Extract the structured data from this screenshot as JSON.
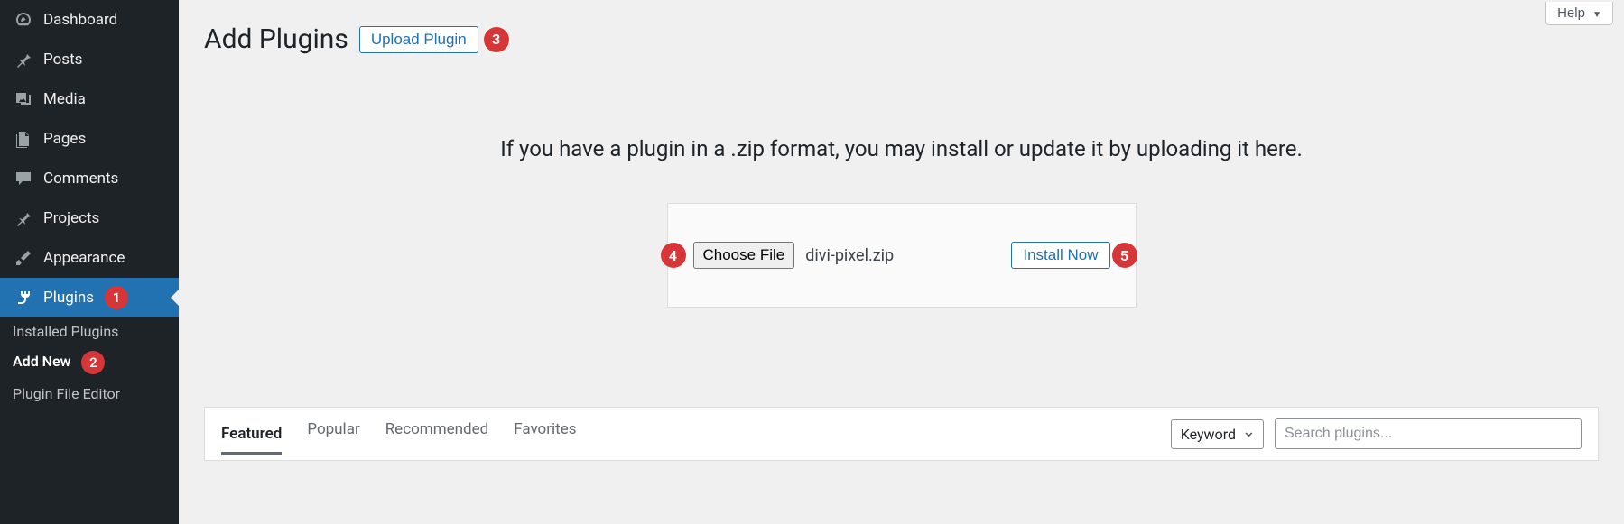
{
  "sidebar": {
    "items": [
      {
        "label": "Dashboard",
        "icon": "gauge"
      },
      {
        "label": "Posts",
        "icon": "pin"
      },
      {
        "label": "Media",
        "icon": "media"
      },
      {
        "label": "Pages",
        "icon": "pages"
      },
      {
        "label": "Comments",
        "icon": "comment"
      },
      {
        "label": "Projects",
        "icon": "pin"
      },
      {
        "label": "Appearance",
        "icon": "brush"
      },
      {
        "label": "Plugins",
        "icon": "plug",
        "active": true,
        "badge": "1"
      }
    ],
    "submenu": [
      {
        "label": "Installed Plugins"
      },
      {
        "label": "Add New",
        "bold": true,
        "badge": "2"
      },
      {
        "label": "Plugin File Editor"
      }
    ]
  },
  "header": {
    "help_label": "Help",
    "page_title": "Add Plugins",
    "upload_button": "Upload Plugin",
    "upload_badge": "3"
  },
  "upload": {
    "instructions": "If you have a plugin in a .zip format, you may install or update it by uploading it here.",
    "choose_file_label": "Choose File",
    "file_name": "divi-pixel.zip",
    "install_label": "Install Now",
    "badge_choose": "4",
    "badge_install": "5"
  },
  "filter": {
    "tabs": [
      "Featured",
      "Popular",
      "Recommended",
      "Favorites"
    ],
    "active_tab": "Featured",
    "keyword_label": "Keyword",
    "search_placeholder": "Search plugins..."
  },
  "colors": {
    "accent": "#2271b1",
    "badge": "#d63638",
    "sidebar_bg": "#1d2327",
    "body_bg": "#f0f0f1"
  }
}
